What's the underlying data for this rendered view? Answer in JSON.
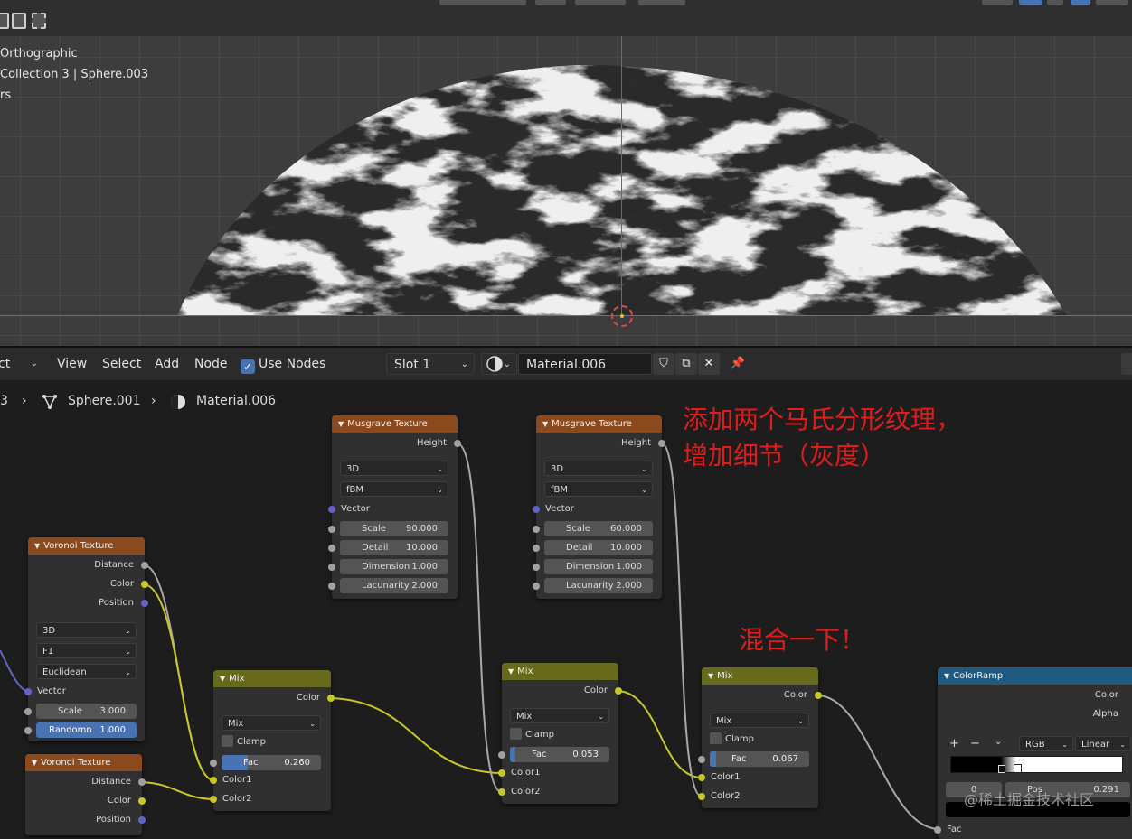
{
  "viewport": {
    "view_mode": "Orthographic",
    "object_path": "Collection 3 | Sphere.003",
    "info_fragment": "rs"
  },
  "node_header": {
    "mode_fragment": "ct",
    "menus": [
      "View",
      "Select",
      "Add",
      "Node"
    ],
    "use_nodes_label": "Use Nodes",
    "use_nodes_checked": true,
    "slot": "Slot 1",
    "material": "Material.006"
  },
  "breadcrumb": {
    "prefix": "3",
    "object": "Sphere.001",
    "material": "Material.006"
  },
  "nodes": {
    "voronoi1": {
      "title": "Voronoi Texture",
      "outputs": [
        "Distance",
        "Color",
        "Position"
      ],
      "dims": "3D",
      "feature": "F1",
      "metric": "Euclidean",
      "vector_label": "Vector",
      "scale_label": "Scale",
      "scale": "3.000",
      "random_label": "Randomn",
      "random": "1.000"
    },
    "voronoi2": {
      "title": "Voronoi Texture",
      "outputs": [
        "Distance",
        "Color",
        "Position"
      ]
    },
    "musgrave1": {
      "title": "Musgrave Texture",
      "output": "Height",
      "dims": "3D",
      "type": "fBM",
      "vector_label": "Vector",
      "fields": [
        {
          "label": "Scale",
          "value": "90.000"
        },
        {
          "label": "Detail",
          "value": "10.000"
        },
        {
          "label": "Dimension",
          "value": "1.000"
        },
        {
          "label": "Lacunarity",
          "value": "2.000"
        }
      ]
    },
    "musgrave2": {
      "title": "Musgrave Texture",
      "output": "Height",
      "dims": "3D",
      "type": "fBM",
      "vector_label": "Vector",
      "fields": [
        {
          "label": "Scale",
          "value": "60.000"
        },
        {
          "label": "Detail",
          "value": "10.000"
        },
        {
          "label": "Dimension",
          "value": "1.000"
        },
        {
          "label": "Lacunarity",
          "value": "2.000"
        }
      ]
    },
    "mix1": {
      "title": "Mix",
      "output": "Color",
      "blend": "Mix",
      "clamp_label": "Clamp",
      "fac_label": "Fac",
      "fac": "0.260",
      "fac_fraction": 0.26,
      "color1": "Color1",
      "color2": "Color2"
    },
    "mix2": {
      "title": "Mix",
      "output": "Color",
      "blend": "Mix",
      "clamp_label": "Clamp",
      "fac_label": "Fac",
      "fac": "0.053",
      "fac_fraction": 0.053,
      "color1": "Color1",
      "color2": "Color2"
    },
    "mix3": {
      "title": "Mix",
      "output": "Color",
      "blend": "Mix",
      "clamp_label": "Clamp",
      "fac_label": "Fac",
      "fac": "0.067",
      "fac_fraction": 0.067,
      "color1": "Color1",
      "color2": "Color2"
    },
    "colorramp": {
      "title": "ColorRamp",
      "outputs": [
        "Color",
        "Alpha"
      ],
      "add": "+",
      "remove": "−",
      "mode": "RGB",
      "interp": "Linear",
      "index": "0",
      "pos_label": "Pos",
      "pos": "0.291",
      "fac_label": "Fac"
    }
  },
  "annotations": {
    "musgrave_note_line1": "添加两个马氏分形纹理，",
    "musgrave_note_line2": "增加细节（灰度）",
    "mix_note": "混合一下！"
  },
  "watermark": "@稀土掘金技术社区",
  "colors": {
    "texture_header": "#8a4a1e",
    "mix_header": "#666a1a",
    "colorramp_header": "#1f5a80",
    "annotation_red": "#e21c1c",
    "wire_yellow": "#c7c729",
    "wire_gray": "#a8a8a8",
    "accent_blue": "#4772b3"
  }
}
